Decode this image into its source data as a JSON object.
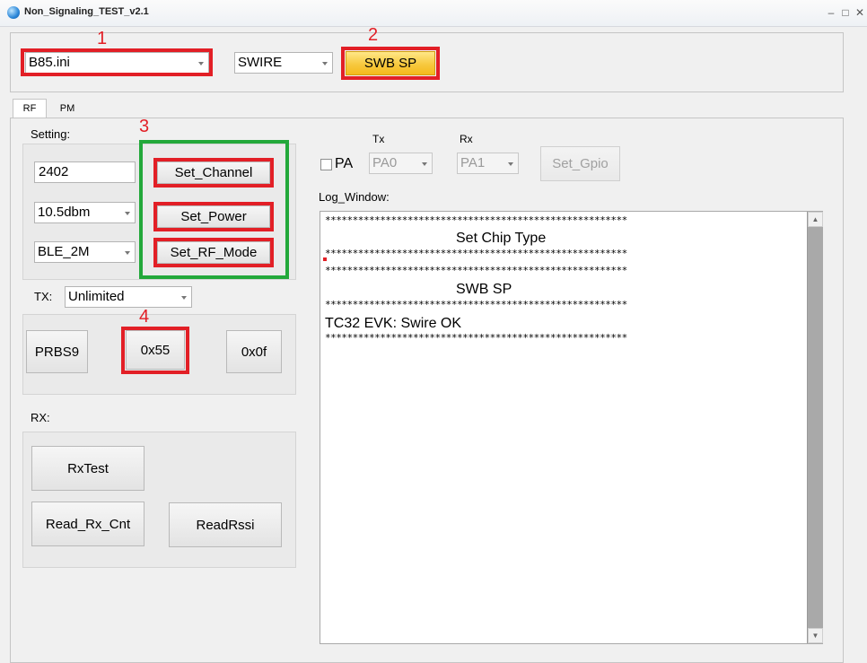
{
  "window": {
    "title": "Non_Signaling_TEST_v2.1",
    "minimize": "–",
    "maximize": "□",
    "close": "✕"
  },
  "top": {
    "config_file": "B85.ini",
    "interface": "SWIRE",
    "swb_button": "SWB SP"
  },
  "tabs": [
    {
      "label": "RF"
    },
    {
      "label": "PM"
    }
  ],
  "setting": {
    "label": "Setting:",
    "channel_value": "2402",
    "power_value": "10.5dbm",
    "rf_mode_value": "BLE_2M",
    "set_channel": "Set_Channel",
    "set_power": "Set_Power",
    "set_rf_mode": "Set_RF_Mode"
  },
  "tx": {
    "label": "TX:",
    "mode_value": "Unlimited",
    "prbs9": "PRBS9",
    "pattern_55": "0x55",
    "pattern_0f": "0x0f"
  },
  "rx": {
    "label": "RX:",
    "rx_test": "RxTest",
    "read_rx_cnt": "Read_Rx_Cnt",
    "read_rssi": "ReadRssi"
  },
  "pa": {
    "checkbox_label": "PA",
    "tx_label": "Tx",
    "rx_label": "Rx",
    "tx_value": "PA0",
    "rx_value": "PA1",
    "set_gpio": "Set_Gpio"
  },
  "log": {
    "label": "Log_Window:",
    "separator": "*******************************************************",
    "lines": [
      "Set Chip Type",
      "SWB SP",
      "TC32 EVK: Swire OK"
    ]
  },
  "annotations": [
    "1",
    "2",
    "3",
    "4"
  ],
  "colors": {
    "annotation_red": "#e21f26",
    "annotation_green": "#22a83a",
    "swb_button_yellow": "#f7c93f"
  }
}
